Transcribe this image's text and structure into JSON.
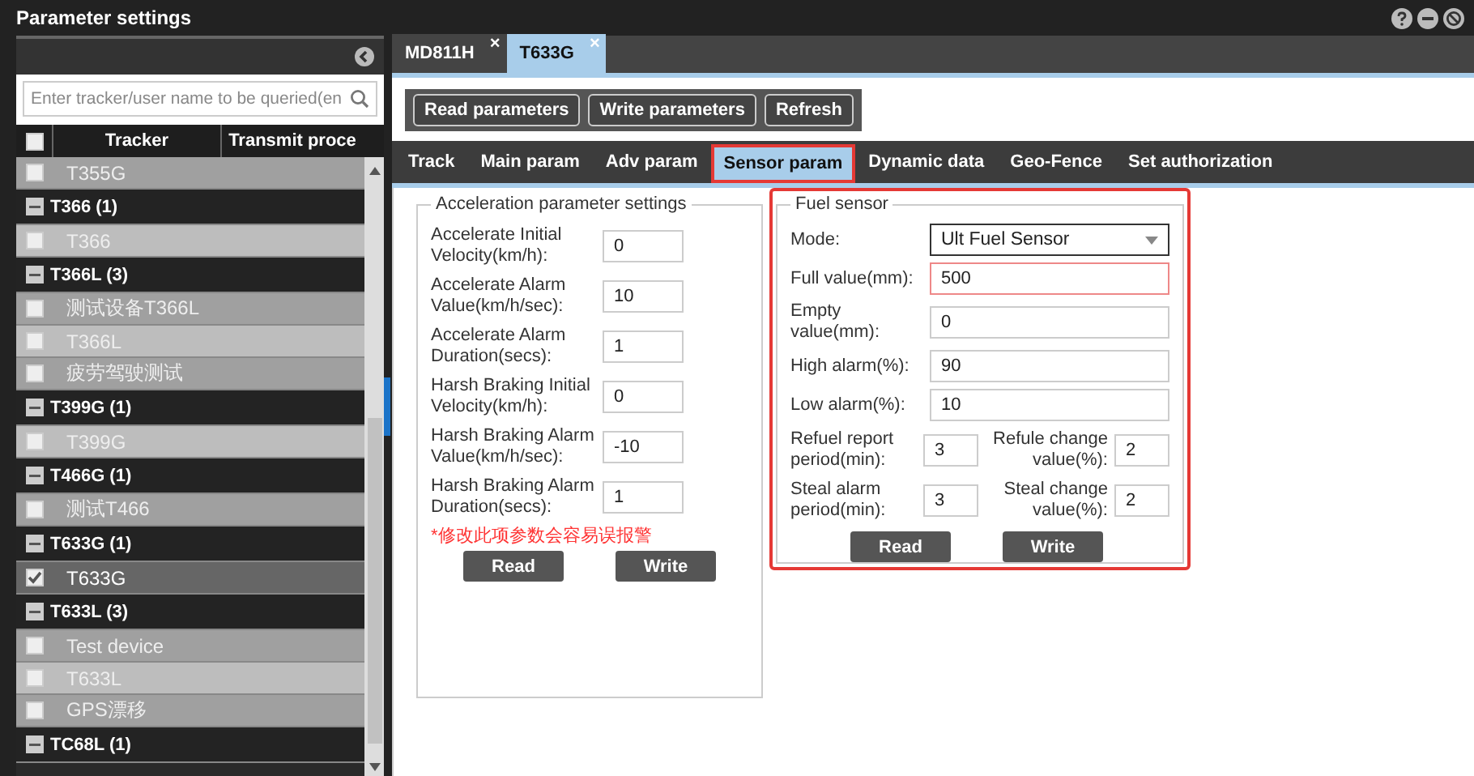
{
  "window": {
    "title": "Parameter settings"
  },
  "sidebar": {
    "search": {
      "placeholder": "Enter tracker/user name to be queried(en"
    },
    "columns": [
      "Tracker",
      "Transmit proce"
    ],
    "all_checked": false,
    "items": [
      {
        "kind": "device",
        "label": "T355G",
        "checked": false,
        "selected": false
      },
      {
        "kind": "group",
        "label": "T366 (1)",
        "expanded": true,
        "children": [
          {
            "kind": "device",
            "label": "T366",
            "checked": false,
            "selected": false
          }
        ]
      },
      {
        "kind": "group",
        "label": "T366L (3)",
        "expanded": true,
        "children": [
          {
            "kind": "device",
            "label": "测试设备T366L",
            "checked": false,
            "selected": false
          },
          {
            "kind": "device",
            "label": "T366L",
            "checked": false,
            "selected": false
          },
          {
            "kind": "device",
            "label": "疲劳驾驶测试",
            "checked": false,
            "selected": false
          }
        ]
      },
      {
        "kind": "group",
        "label": "T399G (1)",
        "expanded": true,
        "children": [
          {
            "kind": "device",
            "label": "T399G",
            "checked": false,
            "selected": false
          }
        ]
      },
      {
        "kind": "group",
        "label": "T466G (1)",
        "expanded": true,
        "children": [
          {
            "kind": "device",
            "label": "测试T466",
            "checked": false,
            "selected": false
          }
        ]
      },
      {
        "kind": "group",
        "label": "T633G (1)",
        "expanded": true,
        "children": [
          {
            "kind": "device",
            "label": "T633G",
            "checked": true,
            "selected": true
          }
        ]
      },
      {
        "kind": "group",
        "label": "T633L (3)",
        "expanded": true,
        "children": [
          {
            "kind": "device",
            "label": "Test device",
            "checked": false,
            "selected": false
          },
          {
            "kind": "device",
            "label": "T633L",
            "checked": false,
            "selected": false
          },
          {
            "kind": "device",
            "label": "GPS漂移",
            "checked": false,
            "selected": false
          }
        ]
      },
      {
        "kind": "group",
        "label": "TC68L (1)",
        "expanded": true
      }
    ]
  },
  "device_tabs": [
    {
      "label": "MD811H",
      "selected": false,
      "close": "×"
    },
    {
      "label": "T633G",
      "selected": true,
      "close": "×"
    }
  ],
  "toolbar": [
    "Read parameters",
    "Write parameters",
    "Refresh"
  ],
  "nav_tabs": [
    {
      "label": "Track",
      "selected": false
    },
    {
      "label": "Main param",
      "selected": false
    },
    {
      "label": "Adv param",
      "selected": false
    },
    {
      "label": "Sensor param",
      "selected": true
    },
    {
      "label": "Dynamic data",
      "selected": false
    },
    {
      "label": "Geo-Fence",
      "selected": false
    },
    {
      "label": "Set authorization",
      "selected": false
    }
  ],
  "acceleration": {
    "title": "Acceleration parameter settings",
    "fields": [
      {
        "label": "Accelerate Initial Velocity(km/h):",
        "value": "0"
      },
      {
        "label": "Accelerate Alarm Value(km/h/sec):",
        "value": "10"
      },
      {
        "label": "Accelerate Alarm Duration(secs):",
        "value": "1"
      },
      {
        "label": "Harsh Braking Initial Velocity(km/h):",
        "value": "0"
      },
      {
        "label": "Harsh Braking Alarm Value(km/h/sec):",
        "value": "-10"
      },
      {
        "label": "Harsh Braking Alarm Duration(secs):",
        "value": "1"
      }
    ],
    "warning": "*修改此项参数会容易误报警",
    "buttons": [
      "Read",
      "Write"
    ]
  },
  "fuel_sensor": {
    "title": "Fuel sensor",
    "highlighted": true,
    "mode": {
      "label": "Mode:",
      "value": "Ult Fuel Sensor"
    },
    "fields": [
      {
        "label": "Full value(mm):",
        "value": "500",
        "highlighted": true
      },
      {
        "label": "Empty value(mm):",
        "value": "0",
        "highlighted": false
      },
      {
        "label": "High alarm(%):",
        "value": "90",
        "highlighted": false
      },
      {
        "label": "Low alarm(%):",
        "value": "10",
        "highlighted": false
      }
    ],
    "pairs": [
      {
        "label": "Refuel report period(min):",
        "value": "3",
        "label_2": "Refule change value(%):",
        "value_2": "2"
      },
      {
        "label": "Steal alarm period(min):",
        "value": "3",
        "label_2": "Steal change value(%):",
        "value_2": "2"
      }
    ],
    "buttons": [
      "Read",
      "Write"
    ]
  }
}
